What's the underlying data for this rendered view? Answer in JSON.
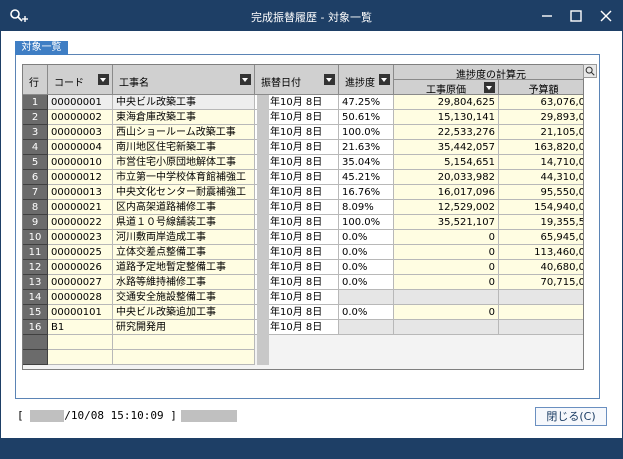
{
  "window": {
    "title": "完成振替履歴 - 対象一覧"
  },
  "tab": {
    "label": "対象一覧"
  },
  "grid": {
    "headers": {
      "row": "行",
      "code": "コード",
      "name": "工事名",
      "date": "振替日付",
      "progress": "進捗度",
      "calc_group": "進捗度の計算元",
      "cost": "工事原価",
      "budget": "予算額"
    },
    "rows": [
      {
        "rn": "1",
        "code": "00000001",
        "name": "中央ビル改築工事",
        "date": "年10月  8日",
        "progress": "47.25%",
        "cost": "29,804,625",
        "budget": "63,076,0"
      },
      {
        "rn": "2",
        "code": "00000002",
        "name": "東海倉庫改築工事",
        "date": "年10月  8日",
        "progress": "50.61%",
        "cost": "15,130,141",
        "budget": "29,893,0"
      },
      {
        "rn": "3",
        "code": "00000003",
        "name": "西山ショールーム改築工事",
        "date": "年10月  8日",
        "progress": "100.0%",
        "cost": "22,533,276",
        "budget": "21,105,0"
      },
      {
        "rn": "4",
        "code": "00000004",
        "name": "南川地区住宅新築工事",
        "date": "年10月  8日",
        "progress": "21.63%",
        "cost": "35,442,057",
        "budget": "163,820,0"
      },
      {
        "rn": "5",
        "code": "00000010",
        "name": "市営住宅小原団地解体工事",
        "date": "年10月  8日",
        "progress": "35.04%",
        "cost": "5,154,651",
        "budget": "14,710,0"
      },
      {
        "rn": "6",
        "code": "00000012",
        "name": "市立第一中学校体育館補強工",
        "date": "年10月  8日",
        "progress": "45.21%",
        "cost": "20,033,982",
        "budget": "44,310,0"
      },
      {
        "rn": "7",
        "code": "00000013",
        "name": "中央文化センター耐震補強工",
        "date": "年10月  8日",
        "progress": "16.76%",
        "cost": "16,017,096",
        "budget": "95,550,0"
      },
      {
        "rn": "8",
        "code": "00000021",
        "name": "区内高架道路補修工事",
        "date": "年10月  8日",
        "progress": "8.09%",
        "cost": "12,529,002",
        "budget": "154,940,0"
      },
      {
        "rn": "9",
        "code": "00000022",
        "name": "県道１０号線舗装工事",
        "date": "年10月  8日",
        "progress": "100.0%",
        "cost": "35,521,107",
        "budget": "19,355,5"
      },
      {
        "rn": "10",
        "code": "00000023",
        "name": "河川敷両岸造成工事",
        "date": "年10月  8日",
        "progress": "0.0%",
        "cost": "0",
        "budget": "65,945,0"
      },
      {
        "rn": "11",
        "code": "00000025",
        "name": "立体交差点整備工事",
        "date": "年10月  8日",
        "progress": "0.0%",
        "cost": "0",
        "budget": "113,460,0"
      },
      {
        "rn": "12",
        "code": "00000026",
        "name": "道路予定地暫定整備工事",
        "date": "年10月  8日",
        "progress": "0.0%",
        "cost": "0",
        "budget": "40,680,0"
      },
      {
        "rn": "13",
        "code": "00000027",
        "name": "水路等維持補修工事",
        "date": "年10月  8日",
        "progress": "0.0%",
        "cost": "0",
        "budget": "70,715,0"
      },
      {
        "rn": "14",
        "code": "00000028",
        "name": "交通安全施設整備工事",
        "date": "年10月  8日",
        "progress": "",
        "cost": "",
        "budget": ""
      },
      {
        "rn": "15",
        "code": "00000101",
        "name": "中央ビル改築追加工事",
        "date": "年10月  8日",
        "progress": "0.0%",
        "cost": "0",
        "budget": ""
      },
      {
        "rn": "16",
        "code": "B1",
        "name": "研究開発用",
        "date": "年10月  8日",
        "progress": "",
        "cost": "",
        "budget": ""
      }
    ]
  },
  "status": {
    "timestamp": "/10/08 15:10:09 ]",
    "open_bracket": "["
  },
  "buttons": {
    "close": "閉じる(C)"
  },
  "colors": {
    "titlebar": "#1e3f66",
    "row_fill": "#fffde2",
    "tab": "#3f7ec4"
  }
}
